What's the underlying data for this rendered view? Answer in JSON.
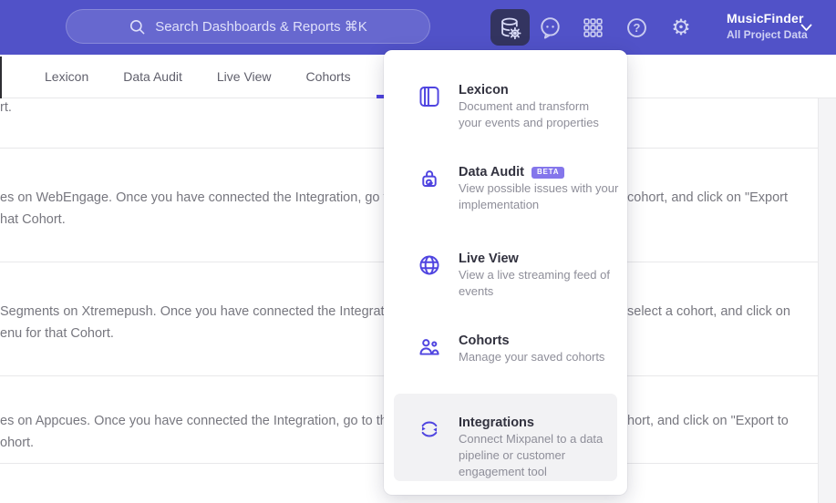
{
  "colors": {
    "header_bg": "#5152C8",
    "accent": "#4F44E0",
    "active_icon_bg": "#333460",
    "badge_bg": "#8476EB",
    "highlight_bg": "#F2F2F4"
  },
  "header": {
    "search_placeholder": "Search Dashboards & Reports ⌘K",
    "project_name": "MusicFinder",
    "project_scope": "All Project Data",
    "icons": [
      "search-icon",
      "data-management-icon",
      "feedback-icon",
      "apps-grid-icon",
      "help-icon",
      "settings-gear-icon",
      "chevron-down-icon"
    ]
  },
  "tabs": [
    {
      "label": "Lexicon"
    },
    {
      "label": "Data Audit"
    },
    {
      "label": "Live View"
    },
    {
      "label": "Cohorts"
    }
  ],
  "menu": {
    "items": [
      {
        "title": "Lexicon",
        "icon": "book-icon",
        "badge": "",
        "description_lines": [
          "Document and transform",
          "your events and properties"
        ]
      },
      {
        "title": "Data Audit",
        "icon": "lock-audit-icon",
        "badge": "BETA",
        "description_lines": [
          "View possible issues with your",
          "implementation"
        ]
      },
      {
        "title": "Live View",
        "icon": "globe-icon",
        "badge": "",
        "description_lines": [
          "View a live streaming feed of",
          "events"
        ]
      },
      {
        "title": "Cohorts",
        "icon": "users-icon",
        "badge": "",
        "description_lines": [
          "Manage your saved cohorts"
        ]
      },
      {
        "title": "Integrations",
        "icon": "sync-arrows-icon",
        "badge": "",
        "highlighted": true,
        "description_lines": [
          "Connect Mixpanel to a data",
          "pipeline or customer",
          "engagement tool"
        ]
      }
    ]
  },
  "rows": [
    {
      "left1": "rt.",
      "left2": "",
      "right": ""
    },
    {
      "left1": "es on WebEngage. Once you have connected the Integration, go to the",
      "left2": "hat Cohort.",
      "right": "cohort, and click on \"Export"
    },
    {
      "left1": "Segments on Xtremepush. Once you have connected the Integration, ",
      "left2": "enu for that Cohort.",
      "right": "select a cohort, and click on"
    },
    {
      "left1": "es on Appcues. Once you have connected the Integration, go to the M",
      "left2": "ohort.",
      "right": "hort, and click on \"Export to"
    }
  ]
}
